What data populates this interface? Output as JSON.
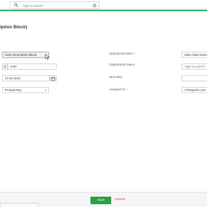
{
  "header": {
    "search_placeholder": "Type to search",
    "accent_color": "#27ae60"
  },
  "page": {
    "title": "iption Block)"
  },
  "left_fields": {
    "description_select": "Hide Description Block",
    "currency_symbol": "$",
    "amount_value": "0.00",
    "date_value": "17-11-2014",
    "sales_stage_value": "Prospecting"
  },
  "right_fields": {
    "opportunity_name_label": "Opportunity Name",
    "opportunity_name_value": "Sale (Hide Descri",
    "organization_name_label": "Organization Name",
    "organization_placeholder": "Type to search",
    "next_step_label": "Next Step",
    "next_step_value": "",
    "assigned_to_label": "Assigned To",
    "assigned_to_value": "VTExperts.com",
    "required_mark": "*"
  },
  "footer": {
    "save_label": "Save",
    "cancel_label": "Cancel",
    "save_color": "#2f9e44",
    "cancel_color": "#c0392b"
  },
  "icons": [
    "search-icon",
    "advanced-search-icon",
    "cursor-pointer-icon",
    "calendar-icon",
    "chevron-down-icon"
  ]
}
